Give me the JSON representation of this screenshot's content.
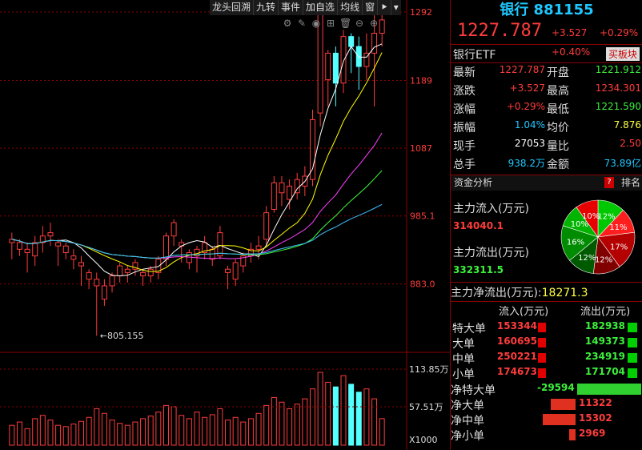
{
  "toolbar": {
    "items": [
      "龙头回溯",
      "九转",
      "事件",
      "加自选",
      "均线",
      "窗"
    ],
    "arrow": "⯈",
    "menu": "▾"
  },
  "tools": [
    "⚙",
    "✎",
    "◉",
    "⊞",
    "🗑",
    "⊖",
    "⊕"
  ],
  "chart_data": {
    "type": "candlestick",
    "y_ticks": [
      "1292",
      "1189",
      "1087",
      "985.1",
      "883.0"
    ],
    "ylim": [
      780,
      1310
    ],
    "low_label": "805.155",
    "volume_ticks": [
      "113.85万",
      "57.51万",
      "X1000"
    ],
    "candles": [
      [
        945,
        950,
        920,
        960
      ],
      [
        935,
        945,
        925,
        950
      ],
      [
        930,
        935,
        900,
        945
      ],
      [
        925,
        945,
        910,
        955
      ],
      [
        945,
        955,
        930,
        970
      ],
      [
        955,
        960,
        940,
        975
      ],
      [
        940,
        945,
        910,
        950
      ],
      [
        930,
        940,
        920,
        945
      ],
      [
        920,
        925,
        905,
        935
      ],
      [
        910,
        915,
        880,
        925
      ],
      [
        890,
        900,
        875,
        905
      ],
      [
        880,
        890,
        805,
        900
      ],
      [
        860,
        880,
        850,
        890
      ],
      [
        880,
        895,
        870,
        900
      ],
      [
        895,
        910,
        885,
        915
      ],
      [
        900,
        905,
        885,
        910
      ],
      [
        905,
        915,
        895,
        920
      ],
      [
        895,
        900,
        880,
        905
      ],
      [
        895,
        905,
        885,
        910
      ],
      [
        900,
        920,
        890,
        925
      ],
      [
        920,
        955,
        910,
        960
      ],
      [
        955,
        975,
        940,
        980
      ],
      [
        940,
        945,
        915,
        950
      ],
      [
        915,
        930,
        905,
        935
      ],
      [
        925,
        935,
        900,
        940
      ],
      [
        930,
        945,
        920,
        955
      ],
      [
        920,
        935,
        910,
        940
      ],
      [
        925,
        960,
        920,
        970
      ],
      [
        900,
        905,
        875,
        910
      ],
      [
        890,
        915,
        880,
        920
      ],
      [
        910,
        925,
        900,
        930
      ],
      [
        925,
        935,
        915,
        945
      ],
      [
        935,
        940,
        920,
        955
      ],
      [
        950,
        990,
        940,
        1000
      ],
      [
        995,
        1035,
        990,
        1045
      ],
      [
        1020,
        1035,
        1000,
        1045
      ],
      [
        1010,
        1030,
        995,
        1040
      ],
      [
        1020,
        1040,
        1010,
        1050
      ],
      [
        1030,
        1045,
        1015,
        1060
      ],
      [
        1040,
        1130,
        1030,
        1145
      ],
      [
        1140,
        1290,
        1120,
        1300
      ],
      [
        1190,
        1230,
        1150,
        1235
      ],
      [
        1230,
        1185,
        1150,
        1240
      ],
      [
        1185,
        1255,
        1170,
        1265
      ],
      [
        1255,
        1240,
        1200,
        1260
      ],
      [
        1240,
        1210,
        1175,
        1255
      ],
      [
        1210,
        1230,
        1190,
        1260
      ],
      [
        1230,
        1260,
        1150,
        1305
      ],
      [
        1260,
        1280,
        1240,
        1290
      ]
    ],
    "volumes": [
      30,
      35,
      25,
      40,
      45,
      38,
      30,
      28,
      32,
      36,
      42,
      55,
      48,
      38,
      33,
      30,
      35,
      40,
      44,
      50,
      60,
      58,
      45,
      40,
      50,
      42,
      46,
      55,
      38,
      42,
      35,
      40,
      48,
      60,
      72,
      65,
      55,
      62,
      70,
      85,
      110,
      95,
      88,
      105,
      92,
      80,
      85,
      70,
      40
    ]
  },
  "panel": {
    "title": "银行 881155",
    "price": "1227.787",
    "change": "+3.527",
    "change_pct": "+0.29%",
    "etf_label": "银行ETF",
    "etf_pct": "+0.40%",
    "button": "买板块",
    "rows": [
      {
        "l1": "最新",
        "v1": "1227.787",
        "c1": "red",
        "l2": "开盘",
        "v2": "1221.912",
        "c2": "green"
      },
      {
        "l1": "涨跌",
        "v1": "+3.527",
        "c1": "red",
        "l2": "最高",
        "v2": "1234.301",
        "c2": "red"
      },
      {
        "l1": "涨幅",
        "v1": "+0.29%",
        "c1": "red",
        "l2": "最低",
        "v2": "1221.590",
        "c2": "green"
      },
      {
        "l1": "振幅",
        "v1": "1.04%",
        "c1": "cyan",
        "l2": "均价",
        "v2": "7.876",
        "c2": "yellow"
      },
      {
        "l1": "现手",
        "v1": "27053",
        "c1": "white",
        "l2": "量比",
        "v2": "2.50",
        "c2": "red"
      },
      {
        "l1": "总手",
        "v1": "938.2万",
        "c1": "cyan",
        "l2": "金额",
        "v2": "73.89亿",
        "c2": "cyan"
      }
    ],
    "capital_label": "资金分析",
    "help": "?",
    "rank": "排名",
    "inflow_label": "主力流入(万元)",
    "inflow_value": "314040.1",
    "outflow_label": "主力流出(万元)",
    "outflow_value": "332311.5",
    "net_label": "主力净流出(万元):",
    "net_value": "18271.3",
    "pie": [
      {
        "label": "12%",
        "color": "#00c800"
      },
      {
        "label": "11%",
        "color": "#ff1e1e"
      },
      {
        "label": "17%",
        "color": "#b40000"
      },
      {
        "label": "12%",
        "color": "#800000"
      },
      {
        "label": "12%",
        "color": "#005a00"
      },
      {
        "label": "16%",
        "color": "#008c00"
      },
      {
        "label": "10%",
        "color": "#00b400"
      },
      {
        "label": "10%",
        "color": "#e60000"
      }
    ],
    "flow_header": {
      "in": "流入(万元)",
      "out": "流出(万元)"
    },
    "flows": [
      {
        "l": "特大单",
        "in": "153344",
        "out": "182938"
      },
      {
        "l": "大单",
        "in": "160695",
        "out": "149373"
      },
      {
        "l": "中单",
        "in": "250221",
        "out": "234919"
      },
      {
        "l": "小单",
        "in": "174673",
        "out": "171704"
      }
    ],
    "nets": [
      {
        "l": "净特大单",
        "v": "-29594",
        "n": -29594
      },
      {
        "l": "净大单",
        "v": "11322",
        "n": 11322
      },
      {
        "l": "净中单",
        "v": "15302",
        "n": 15302
      },
      {
        "l": "净小单",
        "v": "2969",
        "n": 2969
      }
    ]
  }
}
